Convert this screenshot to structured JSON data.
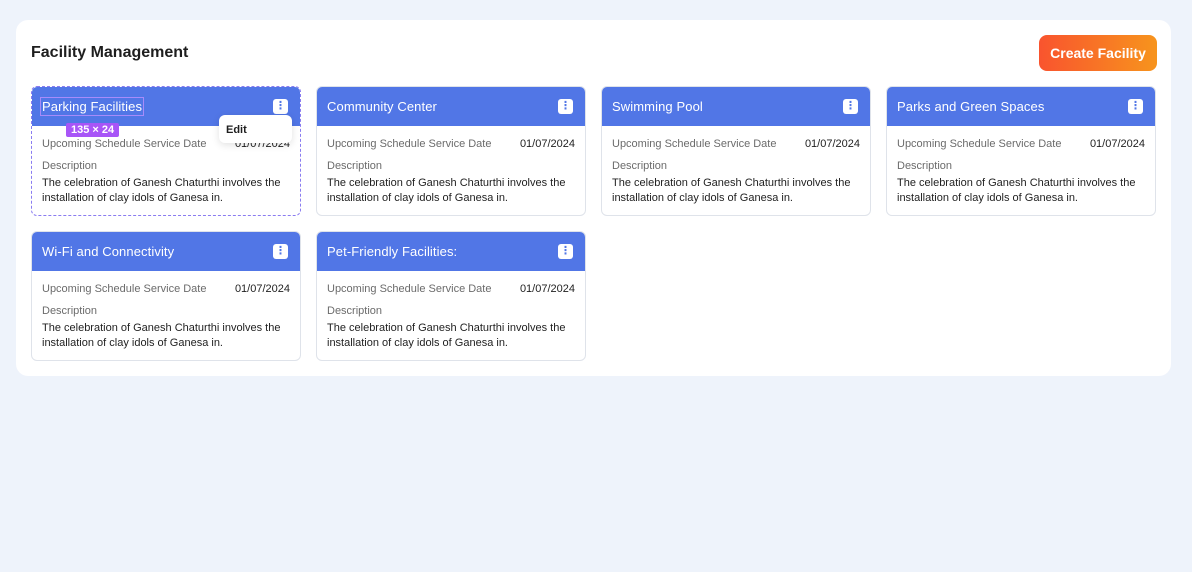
{
  "header": {
    "title": "Facility Management",
    "create_button": "Create Facility"
  },
  "card_common": {
    "schedule_label": "Upcoming Schedule Service Date",
    "description_label": "Description"
  },
  "cards": [
    {
      "title": "Parking Facilities",
      "date": "01/07/2024",
      "description": "The celebration of Ganesh Chaturthi involves the installation of clay idols of Ganesa in."
    },
    {
      "title": "Community Center",
      "date": "01/07/2024",
      "description": "The celebration of Ganesh Chaturthi involves the installation of clay idols of Ganesa in."
    },
    {
      "title": "Swimming Pool",
      "date": "01/07/2024",
      "description": "The celebration of Ganesh Chaturthi involves the installation of clay idols of Ganesa in."
    },
    {
      "title": "Parks and Green Spaces",
      "date": "01/07/2024",
      "description": "The celebration of Ganesh Chaturthi involves the installation of clay idols of Ganesa in."
    },
    {
      "title": "Wi-Fi and Connectivity",
      "date": "01/07/2024",
      "description": "The celebration of Ganesh Chaturthi involves the installation of clay idols of Ganesa in."
    },
    {
      "title": "Pet-Friendly Facilities:",
      "date": "01/07/2024",
      "description": "The celebration of Ganesh Chaturthi involves the installation of clay idols of Ganesa in."
    }
  ],
  "overlay": {
    "size_badge": "135 × 24",
    "context_menu_item": "Edit"
  },
  "icons": {
    "card_menu": "more-vertical-icon"
  },
  "colors": {
    "card_header": "#5176e6",
    "create_gradient_start": "#f9542e",
    "create_gradient_end": "#f7941d",
    "background": "#eef3fb",
    "selection": "#a855f7"
  }
}
